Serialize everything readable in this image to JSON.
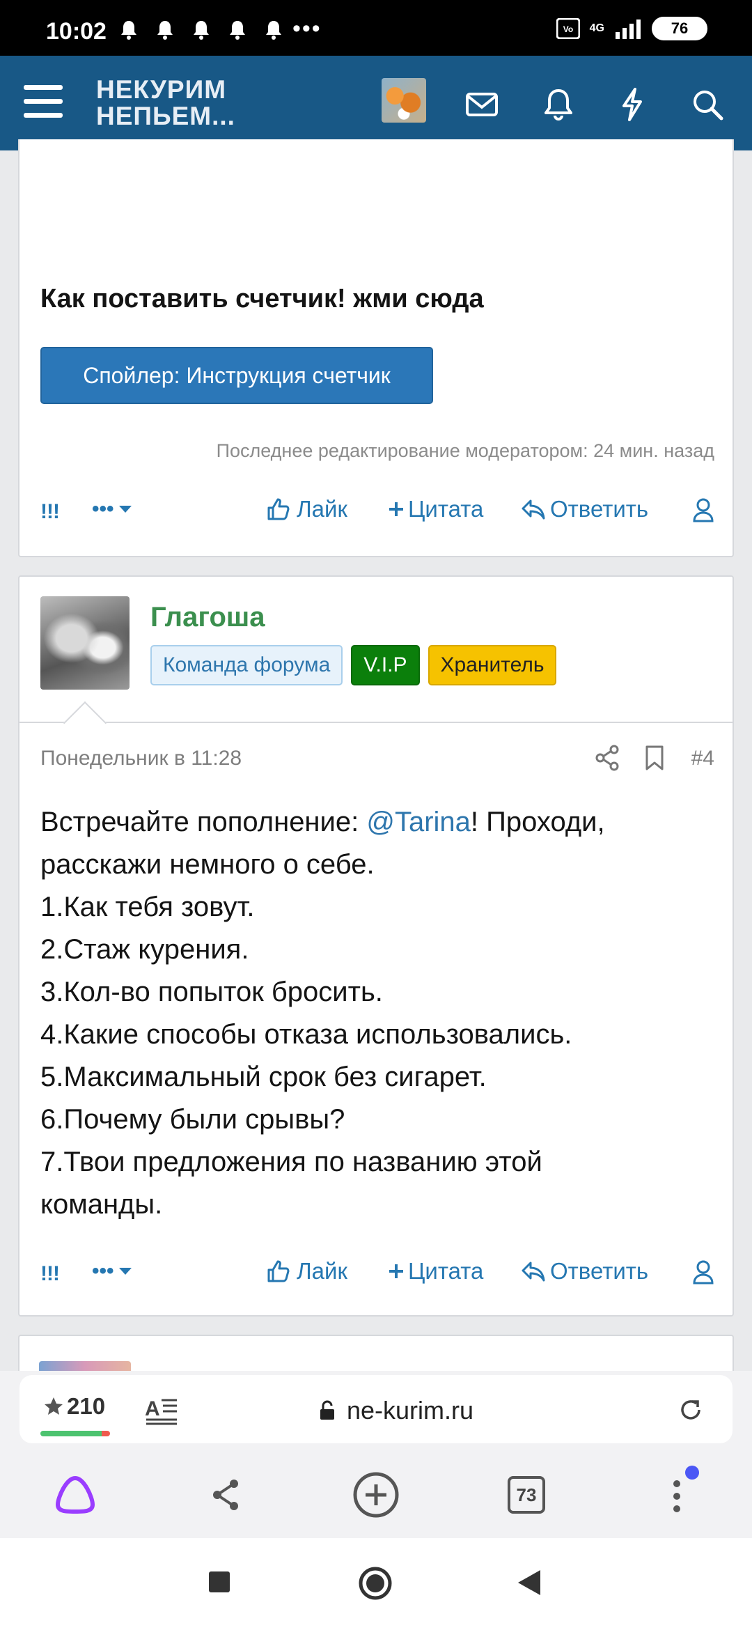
{
  "status_bar": {
    "time": "10:02",
    "dots": "•••",
    "network": "4G",
    "battery": "76"
  },
  "header": {
    "logo_line1": "НЕКУРИМ",
    "logo_line2": "НЕПЬЕМ..."
  },
  "post1": {
    "heading": "Как поставить счетчик! жми сюда",
    "spoiler_label": "Спойлер: Инструкция счетчик",
    "edit_note": "Последнее редактирование модератором: 24 мин. назад"
  },
  "actions": {
    "excl": "!!!",
    "more": "•••",
    "like": "Лайк",
    "quote": "Цитата",
    "reply": "Ответить"
  },
  "post2": {
    "author": "Глагоша",
    "badges": [
      "Команда форума",
      "V.I.P",
      "Хранитель"
    ],
    "date": "Понедельник в 11:28",
    "number": "#4",
    "body_prefix": "Встречайте пополнение: ",
    "mention": "@Tarina",
    "body_line1_suffix": "! Проходи,",
    "body_lines": [
      "расскажи немного о себе.",
      "1.Как тебя зовут.",
      "2.Стаж курения.",
      "3.Кол-во попыток бросить.",
      "4.Какие способы отказа использовались.",
      "5.Максимальный срок без сигарет.",
      "6.Почему были срывы?",
      "7.Твои предложения по названию этой",
      "команды."
    ]
  },
  "browser": {
    "rating": "210",
    "url": "ne-kurim.ru",
    "tabs_count": "73"
  },
  "colors": {
    "header": "#185886",
    "accent": "#2577b1",
    "author": "#3b8f4e",
    "vip": "#0b7f0b",
    "keeper": "#f6c200"
  }
}
